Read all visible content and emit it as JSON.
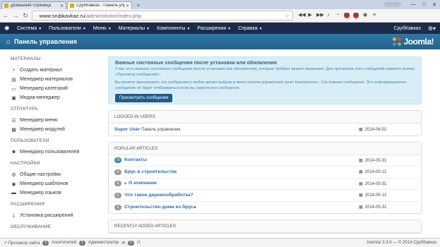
{
  "browser": {
    "tabs": [
      {
        "title": "Домашняя страница",
        "active": false,
        "favicon_color": "#e2a628"
      },
      {
        "title": "СрубКавказ - Панель упра",
        "active": true,
        "favicon_color": "#f0a000"
      }
    ],
    "user": "Aslanoo",
    "badge1": "88",
    "badge2": "39",
    "url_host": "www.srubkavkaz.ru",
    "url_path": "/administrator/index.php"
  },
  "topnav": {
    "menus": [
      "Система",
      "Пользователи",
      "Меню",
      "Материалы",
      "Компоненты",
      "Расширения",
      "Справка"
    ],
    "site_name": "СрубКавказ"
  },
  "header": {
    "title": "Панель управления",
    "brand": "Joomla!"
  },
  "sidebar": {
    "sections": [
      {
        "title": "МАТЕРИАЛЫ",
        "items": [
          {
            "label": "Создать материал",
            "icon": "plus-icon"
          },
          {
            "label": "Менеджер материалов",
            "icon": "doc-icon"
          },
          {
            "label": "Менеджер категорий",
            "icon": "folder-icon"
          },
          {
            "label": "Медиа-менеджер",
            "icon": "image-icon"
          }
        ]
      },
      {
        "title": "СТРУКТУРА",
        "items": [
          {
            "label": "Менеджер меню",
            "icon": "list-icon"
          },
          {
            "label": "Менеджер модулей",
            "icon": "cube-icon"
          }
        ]
      },
      {
        "title": "ПОЛЬЗОВАТЕЛИ",
        "items": [
          {
            "label": "Менеджер пользователей",
            "icon": "users-icon"
          }
        ]
      },
      {
        "title": "НАСТРОЙКИ",
        "items": [
          {
            "label": "Общие настройки",
            "icon": "gear-icon"
          },
          {
            "label": "Менеджер шаблонов",
            "icon": "eye-icon"
          },
          {
            "label": "Менеджер языков",
            "icon": "comment-icon"
          }
        ]
      },
      {
        "title": "РАСШИРЕНИЯ",
        "items": [
          {
            "label": "Установка расширений",
            "icon": "download-icon"
          }
        ]
      },
      {
        "title": "ОБСЛУЖИВАНИЕ",
        "items": []
      }
    ]
  },
  "alert": {
    "heading": "Важные системные сообщения после установки или обновления",
    "text1": "У вас есть важные системные сообщения (после установки или обновления), которые требуют вашего внимания. Для просмотра этих сообщений нажмите кнопку «Просмотр сообщений».",
    "text2": "Вы можете просмотреть эти сообщения в любое время выбрав в меню панели управления пункт Компоненты - Системные сообщения. Это информационное сообщение не будет отображаться если вы скроете все сообщения.",
    "button": "Просмотреть сообщения"
  },
  "logged_in": {
    "title": "LOGGED-IN USERS",
    "rows": [
      {
        "name": "Super User",
        "sub": "Панель управления",
        "date": "2014-06-02"
      }
    ]
  },
  "popular": {
    "title": "POPULAR ARTICLES",
    "rows": [
      {
        "hits": "15",
        "title": "Контакты",
        "date": "2014-05-31",
        "locked": false
      },
      {
        "hits": "6",
        "title": "Брус в строительстве",
        "date": "2014-05-12",
        "locked": false
      },
      {
        "hits": "6",
        "title": "О компании",
        "date": "2014-05-31",
        "locked": true
      },
      {
        "hits": "2",
        "title": "Что такое деревообработка?",
        "date": "2014-05-12",
        "locked": false
      },
      {
        "hits": "2",
        "title": "Строительство дома из бруса",
        "date": "2014-05-31",
        "locked": false
      }
    ]
  },
  "recent": {
    "title": "RECENTLY ADDED ARTICLES"
  },
  "status": {
    "view_site": "Просмотр сайта",
    "visitors_count": "0",
    "visitors_label": "посетителей",
    "admins_count": "1",
    "admins_label": "Администратор",
    "messages_count": "0",
    "copyright": "Joomla! 3.3.0 — © 2014 СрубКавказ"
  }
}
